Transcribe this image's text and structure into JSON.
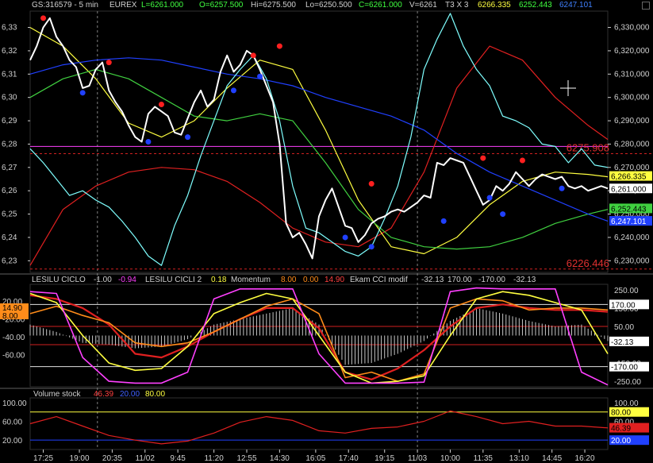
{
  "header": {
    "symbol": "GS:316579 - 5 min",
    "exchange": "EUREX",
    "last": "L=6261.000",
    "open": "O=6257.500",
    "high": "Hi=6275.500",
    "low": "Lo=6250.500",
    "close": "C=6261.000",
    "volume": "V=6261",
    "timeframe": "T3 X 3",
    "val1": "6266.335",
    "val2": "6252.443",
    "val3": "6247.101"
  },
  "panel2": {
    "ind1": "LESILU CICLO",
    "ind1_v1": "-1.00",
    "ind1_v2": "-0.94",
    "ind2": "LESILU CICLI 2",
    "ind2_v": "0.18",
    "ind3": "Momentum",
    "ind3_v1": "8.00",
    "ind3_v2": "0.00",
    "ind3_v3": "14.90",
    "ind4": "Ekam CCI modif",
    "ind4_v1": "-32.13",
    "ind4_v2": "170.00",
    "ind4_v3": "-170.00",
    "ind4_v4": "-32.13"
  },
  "panel3": {
    "ind": "Volume stock",
    "v1": "46.39",
    "v2": "20.00",
    "v3": "80.00"
  },
  "colors": {
    "background": "#000000",
    "price": "#ffffff",
    "cyan": "#7fffff",
    "red": "#e02020",
    "yellow": "#ffff40",
    "green": "#40d040",
    "blue": "#2040ff",
    "magenta": "#ff40ff",
    "orange": "#ff8c1a"
  },
  "chart_data": [
    {
      "type": "line",
      "title": "",
      "x_ticks": [
        "17:25",
        "19:00",
        "20:35",
        "11/02",
        "9:45",
        "11:20",
        "12:55",
        "14:30",
        "16:05",
        "17:40",
        "19:15",
        "11/03",
        "10:00",
        "11:35",
        "13:10",
        "14:45",
        "16:20"
      ],
      "left_axis_ticks": [
        "6,33",
        "6,32",
        "6,31",
        "6,30",
        "6,29",
        "6,28",
        "6,27",
        "6,26",
        "6,25",
        "6,24",
        "6,23"
      ],
      "right_axis_ticks": [
        "6,330,000",
        "6,320,000",
        "6,310,000",
        "6,300,000",
        "6,290,000",
        "6,280,000",
        "6,270,000",
        "6,260,000",
        "6,250,000",
        "6,240,000",
        "6,230,000"
      ],
      "ylim": [
        6225,
        6337
      ],
      "reference_lines": [
        {
          "label": "6275.908",
          "value": 6275.908
        },
        {
          "label": "6226.446",
          "value": 6226.446
        }
      ],
      "right_tags": [
        {
          "label": "6,266.335",
          "value": 6266.335,
          "color": "#ffff40"
        },
        {
          "label": "6,261.000",
          "value": 6261.0,
          "color": "#ffffff"
        },
        {
          "label": "6,252.443",
          "value": 6252.443,
          "color": "#40d040"
        },
        {
          "label": "6,247.101",
          "value": 6247.101,
          "color": "#2040ff"
        }
      ],
      "horizontal_magenta": 6279,
      "series": [
        {
          "color": "#ffffff",
          "x": [
            0,
            2,
            4,
            6,
            8,
            10,
            12,
            14,
            16,
            18,
            20,
            22,
            24,
            26,
            28,
            30,
            32,
            34,
            36,
            38,
            40,
            42,
            44,
            46,
            48,
            50,
            52,
            54,
            56,
            58,
            60,
            62,
            64,
            66,
            68,
            70,
            72,
            74,
            76,
            78,
            80,
            82,
            84,
            86,
            88,
            90,
            92,
            94,
            96,
            98,
            100,
            102,
            104,
            106,
            108,
            110,
            112,
            114,
            116,
            118,
            120,
            122,
            124,
            126,
            128,
            130,
            132,
            134,
            136,
            138,
            140,
            142,
            144,
            146,
            148,
            150,
            152,
            154,
            156,
            158,
            160,
            162,
            164,
            166,
            168,
            170,
            172,
            174,
            176
          ],
          "values": [
            6316,
            6322,
            6330,
            6334,
            6326,
            6322,
            6316,
            6313,
            6304,
            6305,
            6312,
            6315,
            6303,
            6298,
            6294,
            6288,
            6283,
            6281,
            6293,
            6296,
            6294,
            6292,
            6285,
            6284,
            6291,
            6298,
            6303,
            6296,
            6299,
            6311,
            6318,
            6311,
            6314,
            6320,
            6318,
            6312,
            6305,
            6298,
            6280,
            6246,
            6240,
            6242,
            6237,
            6231,
            6249,
            6256,
            6261,
            6253,
            6245,
            6244,
            6238,
            6241,
            6246,
            6248,
            6249,
            6251,
            6252,
            6251,
            6253,
            6255,
            6258,
            6257,
            6272,
            6271,
            6274,
            6273,
            6272,
            6266,
            6260,
            6254,
            6256,
            6262,
            6260,
            6263,
            6268,
            6265,
            6262,
            6265,
            6267,
            6266,
            6265,
            6266,
            6262,
            6261,
            6262,
            6260,
            6261,
            6262,
            6261
          ]
        },
        {
          "color": "#7fffff",
          "x": [
            0,
            4,
            8,
            12,
            16,
            20,
            24,
            28,
            32,
            36,
            40,
            44,
            48,
            52,
            56,
            60,
            64,
            68,
            72,
            76,
            80,
            84,
            88,
            92,
            96,
            100,
            104,
            108,
            112,
            116,
            120,
            124,
            128,
            132,
            136,
            140,
            144,
            148,
            152,
            156,
            160,
            164,
            168,
            172,
            176
          ],
          "values": [
            6278,
            6272,
            6265,
            6258,
            6260,
            6256,
            6253,
            6247,
            6240,
            6232,
            6228,
            6245,
            6258,
            6275,
            6290,
            6305,
            6312,
            6318,
            6308,
            6290,
            6262,
            6244,
            6242,
            6238,
            6234,
            6232,
            6236,
            6248,
            6262,
            6283,
            6312,
            6325,
            6336,
            6322,
            6312,
            6305,
            6292,
            6290,
            6287,
            6280,
            6279,
            6272,
            6278,
            6271,
            6270
          ]
        },
        {
          "color": "#e02020",
          "x": [
            0,
            10,
            20,
            30,
            40,
            50,
            60,
            70,
            80,
            90,
            100,
            110,
            120,
            130,
            140,
            150,
            160,
            170,
            176
          ],
          "values": [
            6228,
            6252,
            6262,
            6268,
            6270,
            6269,
            6264,
            6255,
            6244,
            6238,
            6236,
            6244,
            6268,
            6304,
            6322,
            6316,
            6300,
            6288,
            6282
          ]
        },
        {
          "color": "#ffff40",
          "x": [
            0,
            10,
            20,
            30,
            40,
            50,
            60,
            70,
            80,
            90,
            100,
            110,
            120,
            130,
            140,
            150,
            160,
            170,
            176
          ],
          "values": [
            6330,
            6322,
            6308,
            6289,
            6283,
            6290,
            6304,
            6316,
            6312,
            6286,
            6256,
            6236,
            6233,
            6240,
            6254,
            6264,
            6268,
            6267,
            6266
          ]
        },
        {
          "color": "#40d040",
          "x": [
            0,
            10,
            20,
            30,
            40,
            50,
            60,
            70,
            80,
            90,
            100,
            110,
            120,
            130,
            140,
            150,
            160,
            170,
            176
          ],
          "values": [
            6300,
            6308,
            6312,
            6308,
            6300,
            6292,
            6290,
            6293,
            6290,
            6272,
            6252,
            6240,
            6236,
            6235,
            6236,
            6240,
            6246,
            6250,
            6252
          ]
        },
        {
          "color": "#2040ff",
          "x": [
            0,
            10,
            20,
            30,
            40,
            50,
            60,
            70,
            80,
            90,
            100,
            110,
            120,
            130,
            140,
            150,
            160,
            170,
            176
          ],
          "values": [
            6310,
            6314,
            6316,
            6317,
            6316,
            6313,
            6310,
            6308,
            6305,
            6300,
            6296,
            6292,
            6286,
            6276,
            6268,
            6262,
            6256,
            6250,
            6247
          ]
        }
      ],
      "markers_high": {
        "color": "#ff2020",
        "x": [
          4,
          24,
          40,
          68,
          76,
          104,
          138,
          150
        ],
        "values": [
          6334,
          6315,
          6297,
          6318,
          6322,
          6263,
          6274,
          6273
        ]
      },
      "markers_low": {
        "color": "#2040ff",
        "x": [
          16,
          36,
          48,
          62,
          70,
          96,
          104,
          126,
          140,
          144,
          162
        ],
        "values": [
          6302,
          6281,
          6283,
          6303,
          6309,
          6240,
          6236,
          6247,
          6257,
          6250,
          6261
        ]
      }
    },
    {
      "type": "line",
      "title": "",
      "left_axis_ticks": [
        "20.00",
        "-20.00",
        "-40.00",
        "-60.00"
      ],
      "right_axis_ticks": [
        "250.00",
        "150.00",
        "50.00",
        "-150.00",
        "-250.00"
      ],
      "ylim": [
        -280,
        280
      ],
      "right_tags": [
        {
          "label": "170.00",
          "value": 170
        },
        {
          "label": "-32.13",
          "value": -32
        },
        {
          "label": "-170.00",
          "value": -170
        }
      ],
      "left_tags": [
        {
          "label": "14.90",
          "color": "#ff8c1a"
        },
        {
          "label": "8.00",
          "color": "#ff8c1a"
        }
      ],
      "reference_lines": [
        170,
        50,
        -50,
        -170
      ],
      "series": [
        {
          "color": "#e02020",
          "x": [
            0,
            8,
            16,
            24,
            32,
            40,
            48,
            56,
            64,
            72,
            80,
            88,
            96,
            104,
            112,
            120,
            128,
            136,
            144,
            152,
            160,
            168,
            176
          ],
          "values": [
            220,
            200,
            150,
            60,
            -100,
            -120,
            -60,
            20,
            90,
            150,
            150,
            40,
            -200,
            -240,
            -180,
            -80,
            50,
            150,
            170,
            150,
            140,
            140,
            130
          ]
        },
        {
          "color": "#ff8c1a",
          "x": [
            0,
            8,
            16,
            24,
            32,
            40,
            48,
            56,
            64,
            72,
            80,
            88,
            96,
            104,
            112,
            120,
            128,
            136,
            144,
            152,
            160,
            168,
            176
          ],
          "values": [
            120,
            160,
            110,
            70,
            -40,
            -60,
            -40,
            20,
            90,
            160,
            200,
            120,
            -230,
            -200,
            -250,
            -210,
            150,
            200,
            190,
            140,
            150,
            150,
            140
          ]
        },
        {
          "color": "#ffff40",
          "x": [
            0,
            8,
            16,
            24,
            32,
            40,
            48,
            56,
            64,
            72,
            80,
            88,
            96,
            104,
            112,
            120,
            128,
            136,
            144,
            152,
            160,
            168,
            176
          ],
          "values": [
            230,
            180,
            0,
            -150,
            -190,
            -180,
            -60,
            120,
            180,
            230,
            200,
            0,
            -200,
            -260,
            -250,
            -220,
            0,
            200,
            240,
            220,
            180,
            140,
            -100
          ]
        },
        {
          "color": "#ff40ff",
          "x": [
            0,
            8,
            16,
            24,
            32,
            40,
            48,
            56,
            64,
            72,
            80,
            88,
            96,
            104,
            112,
            120,
            128,
            136,
            144,
            152,
            160,
            168,
            176
          ],
          "values": [
            240,
            230,
            -120,
            -250,
            -260,
            -260,
            -200,
            200,
            255,
            255,
            255,
            -100,
            -260,
            -260,
            -260,
            -255,
            240,
            260,
            255,
            255,
            255,
            -200,
            -270
          ]
        },
        {
          "color": "#ffffff",
          "x": [
            0,
            8,
            16,
            24,
            32,
            40,
            48,
            56,
            64,
            72,
            80,
            88,
            96,
            104,
            112,
            120,
            128,
            136,
            144,
            152,
            160,
            168,
            176
          ],
          "values": [
            60,
            20,
            -40,
            -50,
            -70,
            -60,
            -20,
            60,
            90,
            120,
            150,
            60,
            -160,
            -150,
            -100,
            -30,
            80,
            150,
            120,
            80,
            50,
            60,
            -30
          ]
        }
      ]
    },
    {
      "type": "line",
      "title": "",
      "left_axis_ticks": [
        "100.00",
        "60.00",
        "20.00"
      ],
      "right_axis_ticks": [
        "100.00",
        "60.00"
      ],
      "ylim": [
        0,
        110
      ],
      "right_tags": [
        {
          "label": "80.00",
          "value": 80,
          "color": "#ffff40"
        },
        {
          "label": "46.39",
          "value": 46.39,
          "color": "#e02020"
        },
        {
          "label": "20.00",
          "value": 20,
          "color": "#2040ff"
        }
      ],
      "reference_lines": [
        80,
        20
      ],
      "series": [
        {
          "color": "#e02020",
          "x": [
            0,
            8,
            16,
            24,
            32,
            40,
            48,
            56,
            64,
            72,
            80,
            88,
            96,
            104,
            112,
            120,
            128,
            136,
            144,
            152,
            160,
            168,
            176
          ],
          "values": [
            55,
            70,
            50,
            30,
            20,
            12,
            18,
            35,
            58,
            70,
            62,
            40,
            35,
            45,
            48,
            60,
            82,
            70,
            55,
            60,
            50,
            50,
            46
          ]
        }
      ]
    }
  ]
}
